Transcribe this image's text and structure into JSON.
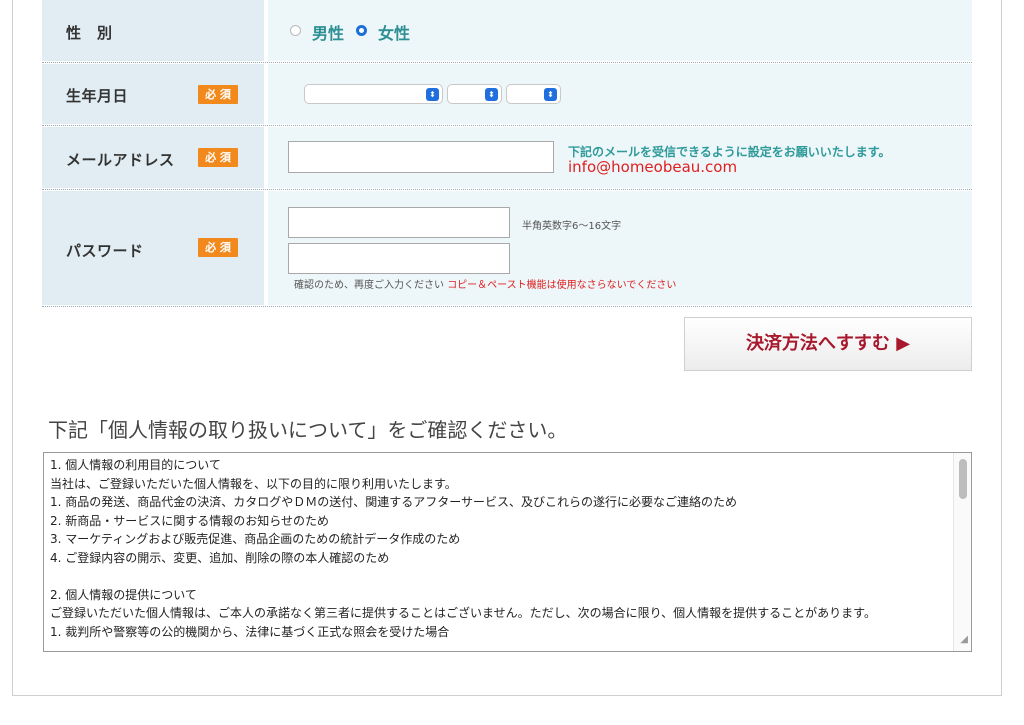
{
  "form": {
    "gender": {
      "label": "性　別",
      "options": [
        {
          "label": "男性",
          "selected": false
        },
        {
          "label": "女性",
          "selected": true
        }
      ]
    },
    "birthday": {
      "label": "生年月日",
      "required_badge": "必 須",
      "selects": [
        "",
        "",
        ""
      ]
    },
    "email": {
      "label": "メールアドレス",
      "required_badge": "必 須",
      "value": "",
      "note": "下記のメールを受信できるように設定をお願いいたします。",
      "address": "info@homeobeau.com"
    },
    "password": {
      "label": "パスワード",
      "required_badge": "必 須",
      "value": "",
      "confirm_value": "",
      "rule_hint": "半角英数字6〜16文字",
      "confirm_hint": "確認のため、再度ご入力ください",
      "warning": "コピー＆ペースト機能は使用なさらないでください"
    },
    "submit_label": "決済方法へすすむ ▶"
  },
  "privacy": {
    "heading": "下記「個人情報の取り扱いについて」をご確認ください。",
    "lines": [
      "1.  個人情報の利用目的について",
      "当社は、ご登録いただいた個人情報を、以下の目的に限り利用いたします。",
      "  1.  商品の発送、商品代金の決済、カタログやＤＭの送付、関連するアフターサービス、及びこれらの遂行に必要なご連絡のため",
      "  2.  新商品・サービスに関する情報のお知らせのため",
      "  3.  マーケティングおよび販売促進、商品企画のための統計データ作成のため",
      "  4.  ご登録内容の開示、変更、追加、削除の際の本人確認のため",
      "",
      "2.  個人情報の提供について",
      "ご登録いただいた個人情報は、ご本人の承諾なく第三者に提供することはございません。ただし、次の場合に限り、個人情報を提供することがあります。",
      "  1.  裁判所や警察等の公的機関から、法律に基づく正式な照会を受けた場合"
    ]
  },
  "colors": {
    "label_bg": "#e1edf2",
    "value_bg": "#edf6f9",
    "required_badge": "#f2891c",
    "accent_teal": "#2c8f93",
    "warning_red": "#e02020",
    "submit_text": "#a8182c"
  }
}
